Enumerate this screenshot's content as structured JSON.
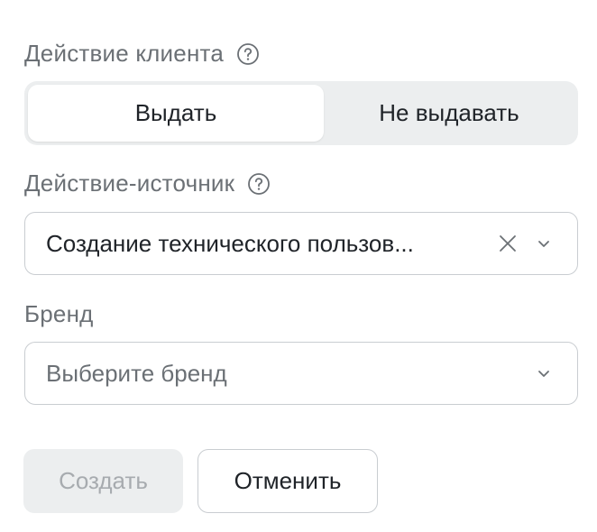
{
  "client_action": {
    "label": "Действие клиента",
    "help_icon": "question-circle-icon",
    "options": [
      {
        "label": "Выдать",
        "selected": true
      },
      {
        "label": "Не выдавать",
        "selected": false
      }
    ]
  },
  "source_action": {
    "label": "Действие-источник",
    "help_icon": "question-circle-icon",
    "value": "Создание технического пользов...",
    "clear_icon": "close-icon",
    "dropdown_icon": "chevron-down-icon"
  },
  "brand": {
    "label": "Бренд",
    "placeholder": "Выберите бренд",
    "dropdown_icon": "chevron-down-icon"
  },
  "actions": {
    "create_label": "Создать",
    "create_disabled": true,
    "cancel_label": "Отменить"
  },
  "colors": {
    "label_text": "#6b7075",
    "primary_text": "#1f2328",
    "segment_bg": "#eceeef",
    "border": "#c9cdd1",
    "disabled_text": "#a7abaf"
  }
}
